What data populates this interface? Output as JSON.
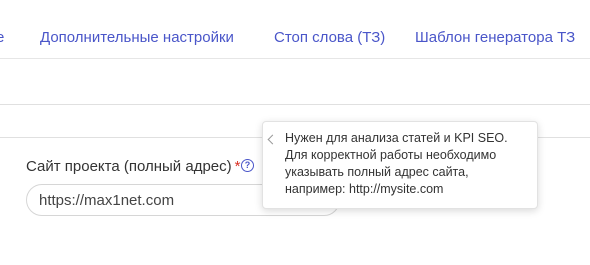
{
  "tabs": [
    {
      "label": "е"
    },
    {
      "label": "Дополнительные настройки"
    },
    {
      "label": "Стоп слова (ТЗ)"
    },
    {
      "label": "Шаблон генератора ТЗ"
    }
  ],
  "field": {
    "label": "Сайт проекта (полный адрес)",
    "required_mark": "*",
    "help_icon": "question-circle-icon",
    "value": "https://max1net.com"
  },
  "tooltip": {
    "text": "Нужен для анализа статей и KPI SEO.\nДля корректной работы необходимо\nуказывать полный адрес сайта,\nнапример: http://mysite.com"
  },
  "colors": {
    "accent": "#4a56c9",
    "required": "#d93025"
  }
}
